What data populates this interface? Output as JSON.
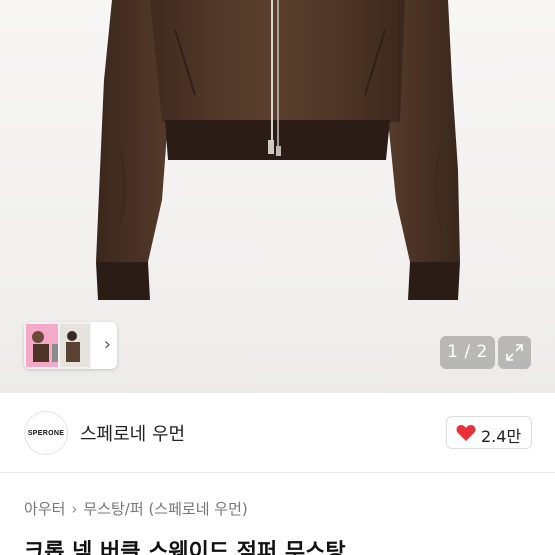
{
  "gallery": {
    "counter": "1 / 2",
    "colors": {
      "jacket": "#4a3325",
      "rib": "#2b1d16",
      "background": "#f3f2f1"
    }
  },
  "seller": {
    "logo_text": "SPERONE",
    "name": "스페로네 우먼"
  },
  "likes": {
    "count": "2.4만",
    "heart_color": "#e8303a"
  },
  "breadcrumb": {
    "items": [
      "아우터",
      "무스탕/퍼",
      "(스페로네 우먼)"
    ]
  },
  "product": {
    "title": "크롭 넥 버클 스웨이드 점퍼 무스탕"
  }
}
